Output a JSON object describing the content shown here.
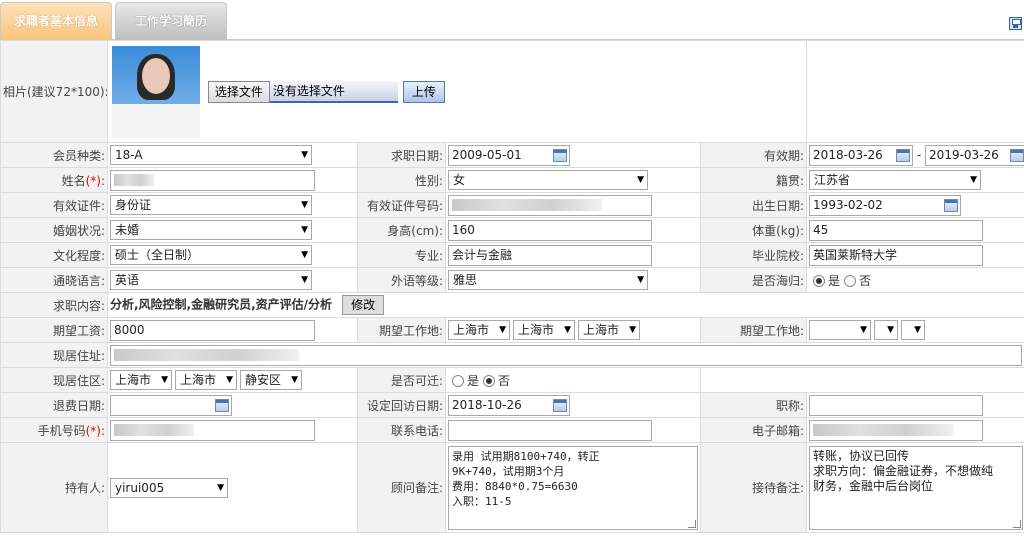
{
  "tabs": {
    "active": "求職者基本信息",
    "inactive": "工作学习簡历"
  },
  "photo": {
    "label": "相片(建议72*100):",
    "choose_file": "选择文件",
    "no_file": "没有选择文件",
    "upload": "上传"
  },
  "row1": {
    "member_type_label": "会员种类:",
    "member_type": "18-A",
    "apply_date_label": "求职日期:",
    "apply_date": "2009-05-01",
    "valid_label": "有效期:",
    "valid_from": "2018-03-26",
    "valid_sep": "-",
    "valid_to": "2019-03-26"
  },
  "row2": {
    "name_label": "姓名",
    "req_mark": "(*)",
    "colon": ":",
    "gender_label": "性别:",
    "gender": "女",
    "native_label": "籍贯:",
    "native": "江苏省"
  },
  "row3": {
    "id_type_label": "有效证件:",
    "id_type": "身份证",
    "id_no_label": "有效证件号码:",
    "birth_label": "出生日期:",
    "birth": "1993-02-02"
  },
  "row4": {
    "marital_label": "婚姻状况:",
    "marital": "未婚",
    "height_label": "身高(cm):",
    "height": "160",
    "weight_label": "体重(kg):",
    "weight": "45"
  },
  "row5": {
    "edu_label": "文化程度:",
    "edu": "硕士（全日制）",
    "major_label": "专业:",
    "major": "会计与金融",
    "school_label": "毕业院校:",
    "school": "英国莱斯特大学"
  },
  "row6": {
    "lang_label": "通晓语言:",
    "lang": "英语",
    "lang_level_label": "外语等级:",
    "lang_level": "雅思",
    "returnee_label": "是否海归:",
    "yes": "是",
    "no": "否"
  },
  "row7": {
    "content_label": "求职内容:",
    "content": "分析,风险控制,金融研究员,资产评估/分析",
    "edit": "修改"
  },
  "row8": {
    "salary_label": "期望工资:",
    "salary": "8000",
    "work_loc_label": "期望工作地:",
    "loc1": "上海市",
    "loc2": "上海市",
    "loc3": "上海市",
    "work_loc2_label": "期望工作地:"
  },
  "row9": {
    "address_label": "现居住址:"
  },
  "row10": {
    "district_label": "现居住区:",
    "d1": "上海市",
    "d2": "上海市",
    "d3": "静安区",
    "relocate_label": "是否可迁:",
    "yes": "是",
    "no": "否"
  },
  "row11": {
    "refund_label": "退费日期:",
    "visit_label": "设定回访日期:",
    "visit": "2018-10-26",
    "title_label": "职称:"
  },
  "row12": {
    "mobile_label": "手机号码",
    "req_mark": "(*)",
    "colon": ":",
    "phone_label": "联系电话:",
    "email_label": "电子邮箱:"
  },
  "row13": {
    "holder_label": "持有人:",
    "holder": "yirui005",
    "consultant_label": "顾问备注:",
    "consultant_note": "录用 试用期8100+740，转正\n9K+740，试用期3个月\n费用：8840*0.75=6630\n入职：11-5",
    "reception_label": "接待备注:",
    "reception_note": "转账，协议已回传\n求职方向：偏金融证券，不想做纯\n财务，金融中后台岗位"
  }
}
